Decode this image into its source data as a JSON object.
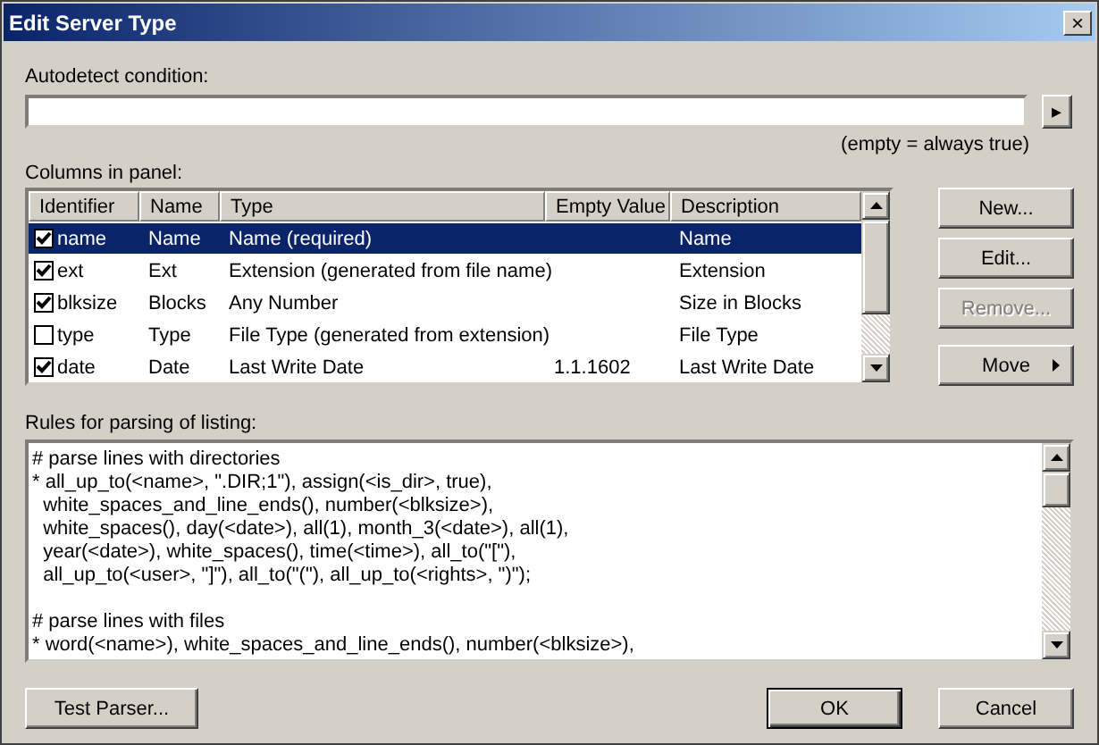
{
  "window": {
    "title": "Edit Server Type",
    "close": "×"
  },
  "autodetect": {
    "label": "Autodetect condition:",
    "button": "▸",
    "hint": "(empty = always true)"
  },
  "columns_panel": {
    "label": "Columns in panel:",
    "columns": [
      "Identifier",
      "Name",
      "Type",
      "Empty Value",
      "Description"
    ],
    "rows": [
      {
        "checked": true,
        "selected": true,
        "cells": [
          "name",
          "Name",
          "Name (required)",
          "",
          "Name"
        ]
      },
      {
        "checked": true,
        "selected": false,
        "cells": [
          "ext",
          "Ext",
          "Extension (generated from file name)",
          "",
          "Extension"
        ]
      },
      {
        "checked": true,
        "selected": false,
        "cells": [
          "blksize",
          "Blocks",
          "Any Number",
          "",
          "Size in Blocks"
        ]
      },
      {
        "checked": false,
        "selected": false,
        "cells": [
          "type",
          "Type",
          "File Type (generated from extension)",
          "",
          "File Type"
        ]
      },
      {
        "checked": true,
        "selected": false,
        "cells": [
          "date",
          "Date",
          "Last Write Date",
          "1.1.1602",
          "Last Write Date"
        ]
      }
    ],
    "buttons": [
      {
        "label": "New...",
        "disabled": false,
        "kind": "plain"
      },
      {
        "label": "Edit...",
        "disabled": false,
        "kind": "plain"
      },
      {
        "label": "Remove...",
        "disabled": true,
        "kind": "plain"
      },
      {
        "label": "Move",
        "disabled": false,
        "kind": "menu"
      }
    ]
  },
  "rules": {
    "label": "Rules for parsing of listing:",
    "blocks": [
      [
        "# parse lines with directories",
        "* all_up_to(<name>, \".DIR;1\"), assign(<is_dir>, true),",
        "  white_spaces_and_line_ends(), number(<blksize>),",
        "  white_spaces(), day(<date>), all(1), month_3(<date>), all(1),",
        "  year(<date>), white_spaces(), time(<time>), all_to(\"[\"),",
        "  all_up_to(<user>, \"]\"), all_to(\"(\"), all_up_to(<rights>, \")\");"
      ],
      [
        "# parse lines with files",
        "* word(<name>), white_spaces_and_line_ends(), number(<blksize>),"
      ]
    ]
  },
  "footer_buttons": [
    {
      "label": "Test Parser...",
      "default": false
    },
    {
      "label": "OK",
      "default": true
    },
    {
      "label": "Cancel",
      "default": false
    }
  ]
}
